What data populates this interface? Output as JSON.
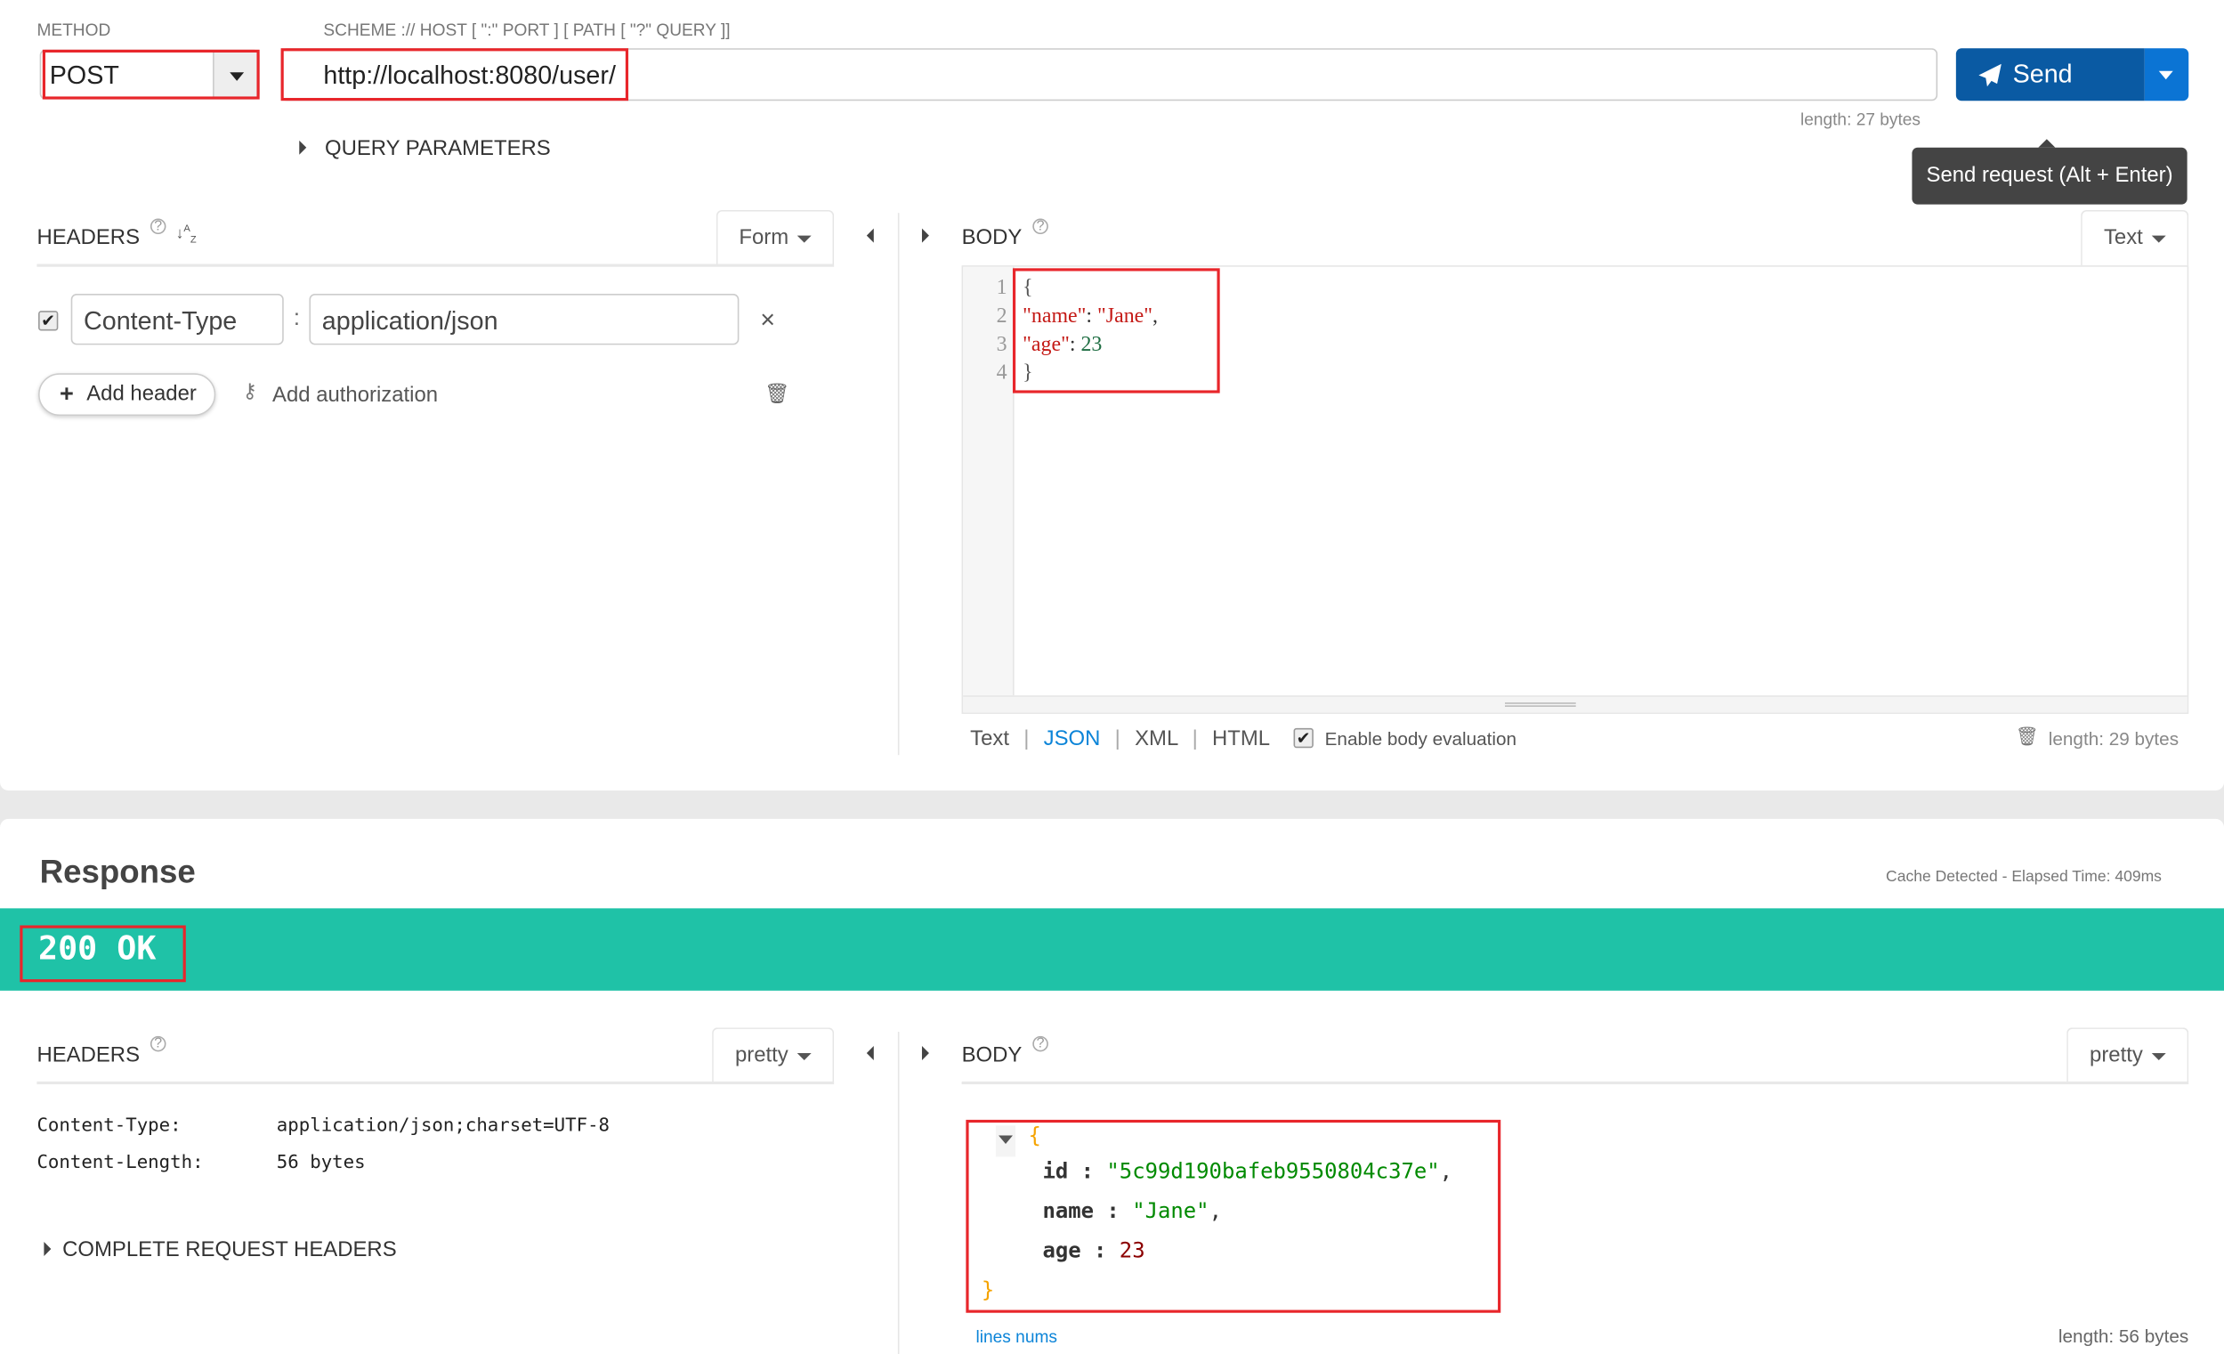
{
  "request": {
    "method_label": "METHOD",
    "url_label": "SCHEME :// HOST [ \":\" PORT ] [ PATH [ \"?\" QUERY ]]",
    "method": "POST",
    "url": "http://localhost:8080/user/",
    "url_length": "length: 27 bytes",
    "send_label": "Send",
    "send_tooltip": "Send request (Alt + Enter)",
    "query_parameters": "QUERY PARAMETERS",
    "headers": {
      "title": "HEADERS",
      "mode": "Form",
      "items": [
        {
          "enabled": true,
          "name": "Content-Type",
          "value": "application/json"
        }
      ],
      "add_header": "Add header",
      "add_authorization": "Add authorization"
    },
    "body": {
      "title": "BODY",
      "mode": "Text",
      "lines": [
        {
          "n": "1",
          "text": "{"
        },
        {
          "n": "2",
          "key": "\"name\"",
          "sep": ": ",
          "value": "\"Jane\"",
          "tail": ","
        },
        {
          "n": "3",
          "key": "\"age\"",
          "sep": ": ",
          "value": "23",
          "tail": ""
        },
        {
          "n": "4",
          "text": "}"
        }
      ],
      "formats": [
        "Text",
        "JSON",
        "XML",
        "HTML"
      ],
      "active_format": "JSON",
      "enable_eval": "Enable body evaluation",
      "length": "length: 29 bytes"
    }
  },
  "response": {
    "title": "Response",
    "meta": "Cache Detected - Elapsed Time: 409ms",
    "status": "200 OK",
    "status_color": "#1fc2a7",
    "headers": {
      "title": "HEADERS",
      "mode": "pretty",
      "items": [
        {
          "name": "Content-Type:",
          "value": "application/json;charset=UTF-8"
        },
        {
          "name": "Content-Length:",
          "value": "56 bytes"
        }
      ],
      "complete": "COMPLETE REQUEST HEADERS"
    },
    "body": {
      "title": "BODY",
      "mode": "pretty",
      "open": "{",
      "fields": [
        {
          "key": "id",
          "value": "\"5c99d190bafeb9550804c37e\"",
          "tail": ",",
          "type": "string"
        },
        {
          "key": "name",
          "value": "\"Jane\"",
          "tail": ",",
          "type": "string"
        },
        {
          "key": "age",
          "value": "23",
          "tail": "",
          "type": "number"
        }
      ],
      "close": "}",
      "lines_nums": "lines nums",
      "length": "length: 56 bytes"
    }
  }
}
